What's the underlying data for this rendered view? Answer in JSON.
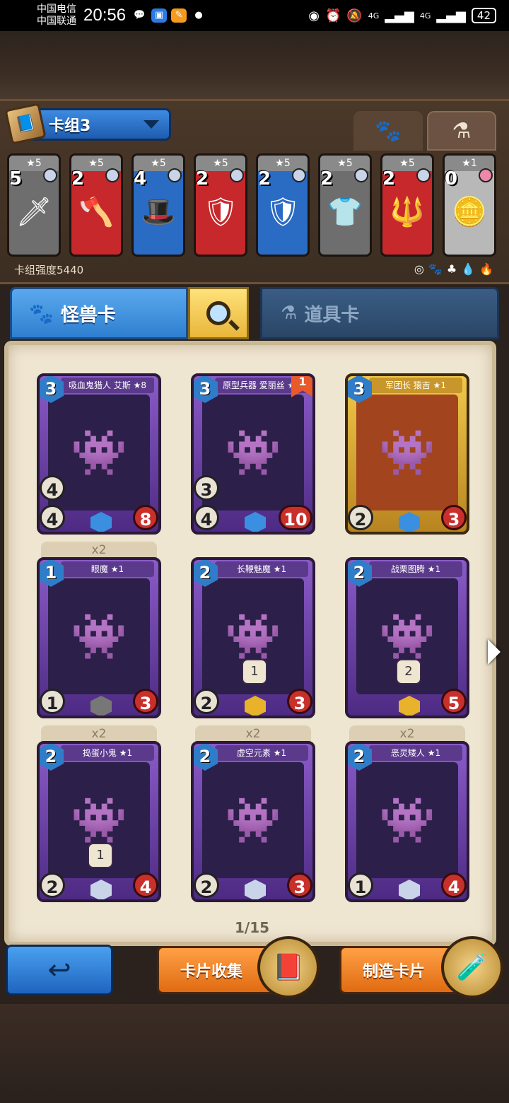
{
  "status": {
    "carrier1": "中国电信",
    "carrier2": "中国联通",
    "time": "20:56",
    "battery": "42",
    "signal1": "4G",
    "signal2": "4G"
  },
  "deck": {
    "name": "卡组3",
    "strength_label": "卡组强度5440",
    "cards": [
      {
        "stars": "★5",
        "cost": "5",
        "theme": "gray",
        "icon": "sword-icon",
        "glyph": "🗡"
      },
      {
        "stars": "★5",
        "cost": "2",
        "theme": "red",
        "icon": "axe-icon",
        "glyph": "🪓"
      },
      {
        "stars": "★5",
        "cost": "4",
        "theme": "blue",
        "icon": "hat-icon",
        "glyph": "🎩"
      },
      {
        "stars": "★5",
        "cost": "2",
        "theme": "red",
        "icon": "gauntlet-icon",
        "glyph": "🛡"
      },
      {
        "stars": "★5",
        "cost": "2",
        "theme": "blue",
        "icon": "gauntlet-icon",
        "glyph": "🛡"
      },
      {
        "stars": "★5",
        "cost": "2",
        "theme": "gray",
        "icon": "tunic-icon",
        "glyph": "👕"
      },
      {
        "stars": "★5",
        "cost": "2",
        "theme": "red",
        "icon": "spear-icon",
        "glyph": "🔱"
      },
      {
        "stars": "★1",
        "cost": "0",
        "theme": "gold",
        "icon": "coin-icon",
        "glyph": "🪙"
      }
    ]
  },
  "tabs": {
    "monster": "怪兽卡",
    "item": "道具卡"
  },
  "cards": [
    {
      "name": "吸血鬼猎人 艾斯 ★8",
      "cost": "3",
      "atk": "4",
      "speed": "4",
      "hp": "8",
      "style": "purple",
      "rarity": "#3b8fe0",
      "dup": ""
    },
    {
      "name": "原型兵器 爱丽丝 ★8",
      "cost": "3",
      "atk": "4",
      "speed": "3",
      "hp": "10",
      "style": "purple",
      "rarity": "#3b8fe0",
      "dup": "",
      "flag": "1"
    },
    {
      "name": "军团长 猿吉 ★1",
      "cost": "3",
      "atk": "2",
      "speed": "",
      "hp": "3",
      "style": "gold",
      "rarity": "#3b8fe0",
      "dup": ""
    },
    {
      "name": "眼魔 ★1",
      "cost": "1",
      "atk": "1",
      "speed": "",
      "hp": "3",
      "style": "purple",
      "rarity": "#777",
      "dup": "x2"
    },
    {
      "name": "长鞭魅魔 ★1",
      "cost": "2",
      "atk": "2",
      "speed": "",
      "hp": "3",
      "style": "purple",
      "rarity": "#e8b22a",
      "dup": "",
      "ability": "1"
    },
    {
      "name": "战栗图腾 ★1",
      "cost": "2",
      "atk": "",
      "speed": "",
      "hp": "5",
      "style": "purple",
      "rarity": "#e8b22a",
      "dup": "",
      "ability": "2"
    },
    {
      "name": "捣蛋小鬼 ★1",
      "cost": "2",
      "atk": "2",
      "speed": "",
      "hp": "4",
      "style": "purple",
      "rarity": "#c9d4e8",
      "dup": "x2",
      "ability": "1"
    },
    {
      "name": "虚空元素 ★1",
      "cost": "2",
      "atk": "2",
      "speed": "",
      "hp": "3",
      "style": "purple",
      "rarity": "#c9d4e8",
      "dup": "x2"
    },
    {
      "name": "恶灵矮人 ★1",
      "cost": "2",
      "atk": "1",
      "speed": "",
      "hp": "4",
      "style": "purple",
      "rarity": "#c9d4e8",
      "dup": "x2"
    }
  ],
  "pager": "1/15",
  "buttons": {
    "collect": "卡片收集",
    "craft": "制造卡片"
  }
}
